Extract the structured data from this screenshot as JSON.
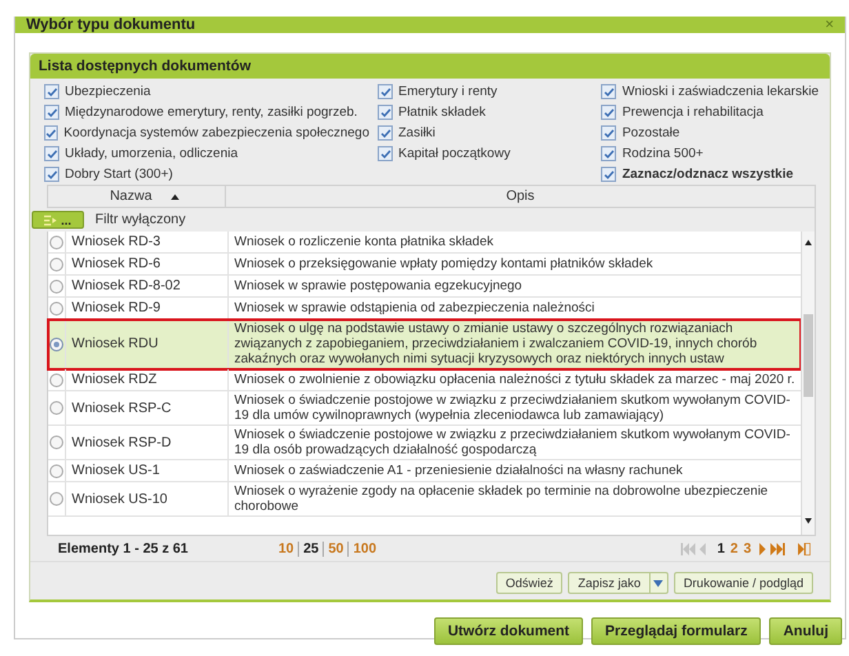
{
  "dialog": {
    "title": "Wybór typu dokumentu",
    "close": "×"
  },
  "panel": {
    "title": "Lista dostępnych dokumentów"
  },
  "filter_columns": [
    [
      {
        "label": "Ubezpieczenia",
        "checked": true,
        "kind": "category"
      },
      {
        "label": "Międzynarodowe emerytury, renty, zasiłki pogrzeb.",
        "checked": true,
        "kind": "category"
      },
      {
        "label": "Koordynacja systemów zabezpieczenia społecznego",
        "checked": true,
        "kind": "category"
      },
      {
        "label": "Układy, umorzenia, odliczenia",
        "checked": true,
        "kind": "category"
      },
      {
        "label": "Dobry Start (300+)",
        "checked": true,
        "kind": "category"
      }
    ],
    [
      {
        "label": "Emerytury i renty",
        "checked": true,
        "kind": "category"
      },
      {
        "label": "Płatnik składek",
        "checked": true,
        "kind": "category"
      },
      {
        "label": "Zasiłki",
        "checked": true,
        "kind": "category"
      },
      {
        "label": "Kapitał początkowy",
        "checked": true,
        "kind": "category"
      }
    ],
    [
      {
        "label": "Wnioski i zaświadczenia lekarskie",
        "checked": true,
        "kind": "category"
      },
      {
        "label": "Prewencja i rehabilitacja",
        "checked": true,
        "kind": "category"
      },
      {
        "label": "Pozostałe",
        "checked": true,
        "kind": "category"
      },
      {
        "label": "Rodzina 500+",
        "checked": true,
        "kind": "category"
      },
      {
        "label": "Zaznacz/odznacz wszystkie",
        "checked": true,
        "kind": "all"
      }
    ]
  ],
  "table": {
    "columns": [
      "Nazwa",
      "Opis"
    ],
    "filter": {
      "button": "...",
      "status": "Filtr wyłączony"
    },
    "rows": [
      {
        "name": "Wniosek RD-3",
        "description": "Wniosek o rozliczenie konta płatnika składek",
        "selected": false
      },
      {
        "name": "Wniosek RD-6",
        "description": "Wniosek o przeksięgowanie wpłaty pomiędzy kontami płatników składek",
        "selected": false
      },
      {
        "name": "Wniosek RD-8-02",
        "description": "Wniosek w sprawie postępowania egzekucyjnego",
        "selected": false
      },
      {
        "name": "Wniosek RD-9",
        "description": "Wniosek w sprawie odstąpienia od zabezpieczenia należności",
        "selected": false
      },
      {
        "name": "Wniosek RDU",
        "description": "Wniosek o ulgę na podstawie ustawy o zmianie ustawy o szczególnych rozwiązaniach związanych z zapobieganiem, przeciwdziałaniem i zwalczaniem COVID-19, innych chorób zakaźnych oraz wywołanych nimi sytuacji kryzysowych oraz niektórych innych ustaw",
        "selected": true
      },
      {
        "name": "Wniosek RDZ",
        "description": "Wniosek o zwolnienie z obowiązku opłacenia należności z tytułu składek za marzec - maj 2020 r.",
        "selected": false
      },
      {
        "name": "Wniosek RSP-C",
        "description": "Wniosek o świadczenie postojowe w związku z przeciwdziałaniem skutkom wywołanym COVID-19 dla umów cywilnoprawnych (wypełnia zleceniodawca lub zamawiający)",
        "selected": false
      },
      {
        "name": "Wniosek RSP-D",
        "description": "Wniosek o świadczenie postojowe w związku z przeciwdziałaniem skutkom wywołanym COVID-19 dla osób prowadzących działalność gospodarczą",
        "selected": false
      },
      {
        "name": "Wniosek US-1",
        "description": "Wniosek o zaświadczenie A1 - przeniesienie działalności na własny rachunek",
        "selected": false
      },
      {
        "name": "Wniosek US-10",
        "description": "Wniosek o wyrażenie zgody na opłacenie składek po terminie na dobrowolne ubezpieczenie chorobowe",
        "selected": false
      }
    ]
  },
  "pager": {
    "summary": "Elementy 1 - 25 z 61",
    "page_sizes": [
      {
        "label": "10",
        "selected": false
      },
      {
        "label": "25",
        "selected": true
      },
      {
        "label": "50",
        "selected": false
      },
      {
        "label": "100",
        "selected": false
      }
    ],
    "pages": [
      {
        "label": "1",
        "selected": true
      },
      {
        "label": "2",
        "selected": false
      },
      {
        "label": "3",
        "selected": false
      }
    ],
    "back_disabled": true
  },
  "toolbar": [
    {
      "label": "Odśwież",
      "kind": "button"
    },
    {
      "label": "Zapisz jako",
      "kind": "split"
    },
    {
      "label": "Drukowanie / podgląd",
      "kind": "button"
    }
  ],
  "actions": [
    "Utwórz dokument",
    "Przeglądaj formularz",
    "Anuluj"
  ]
}
